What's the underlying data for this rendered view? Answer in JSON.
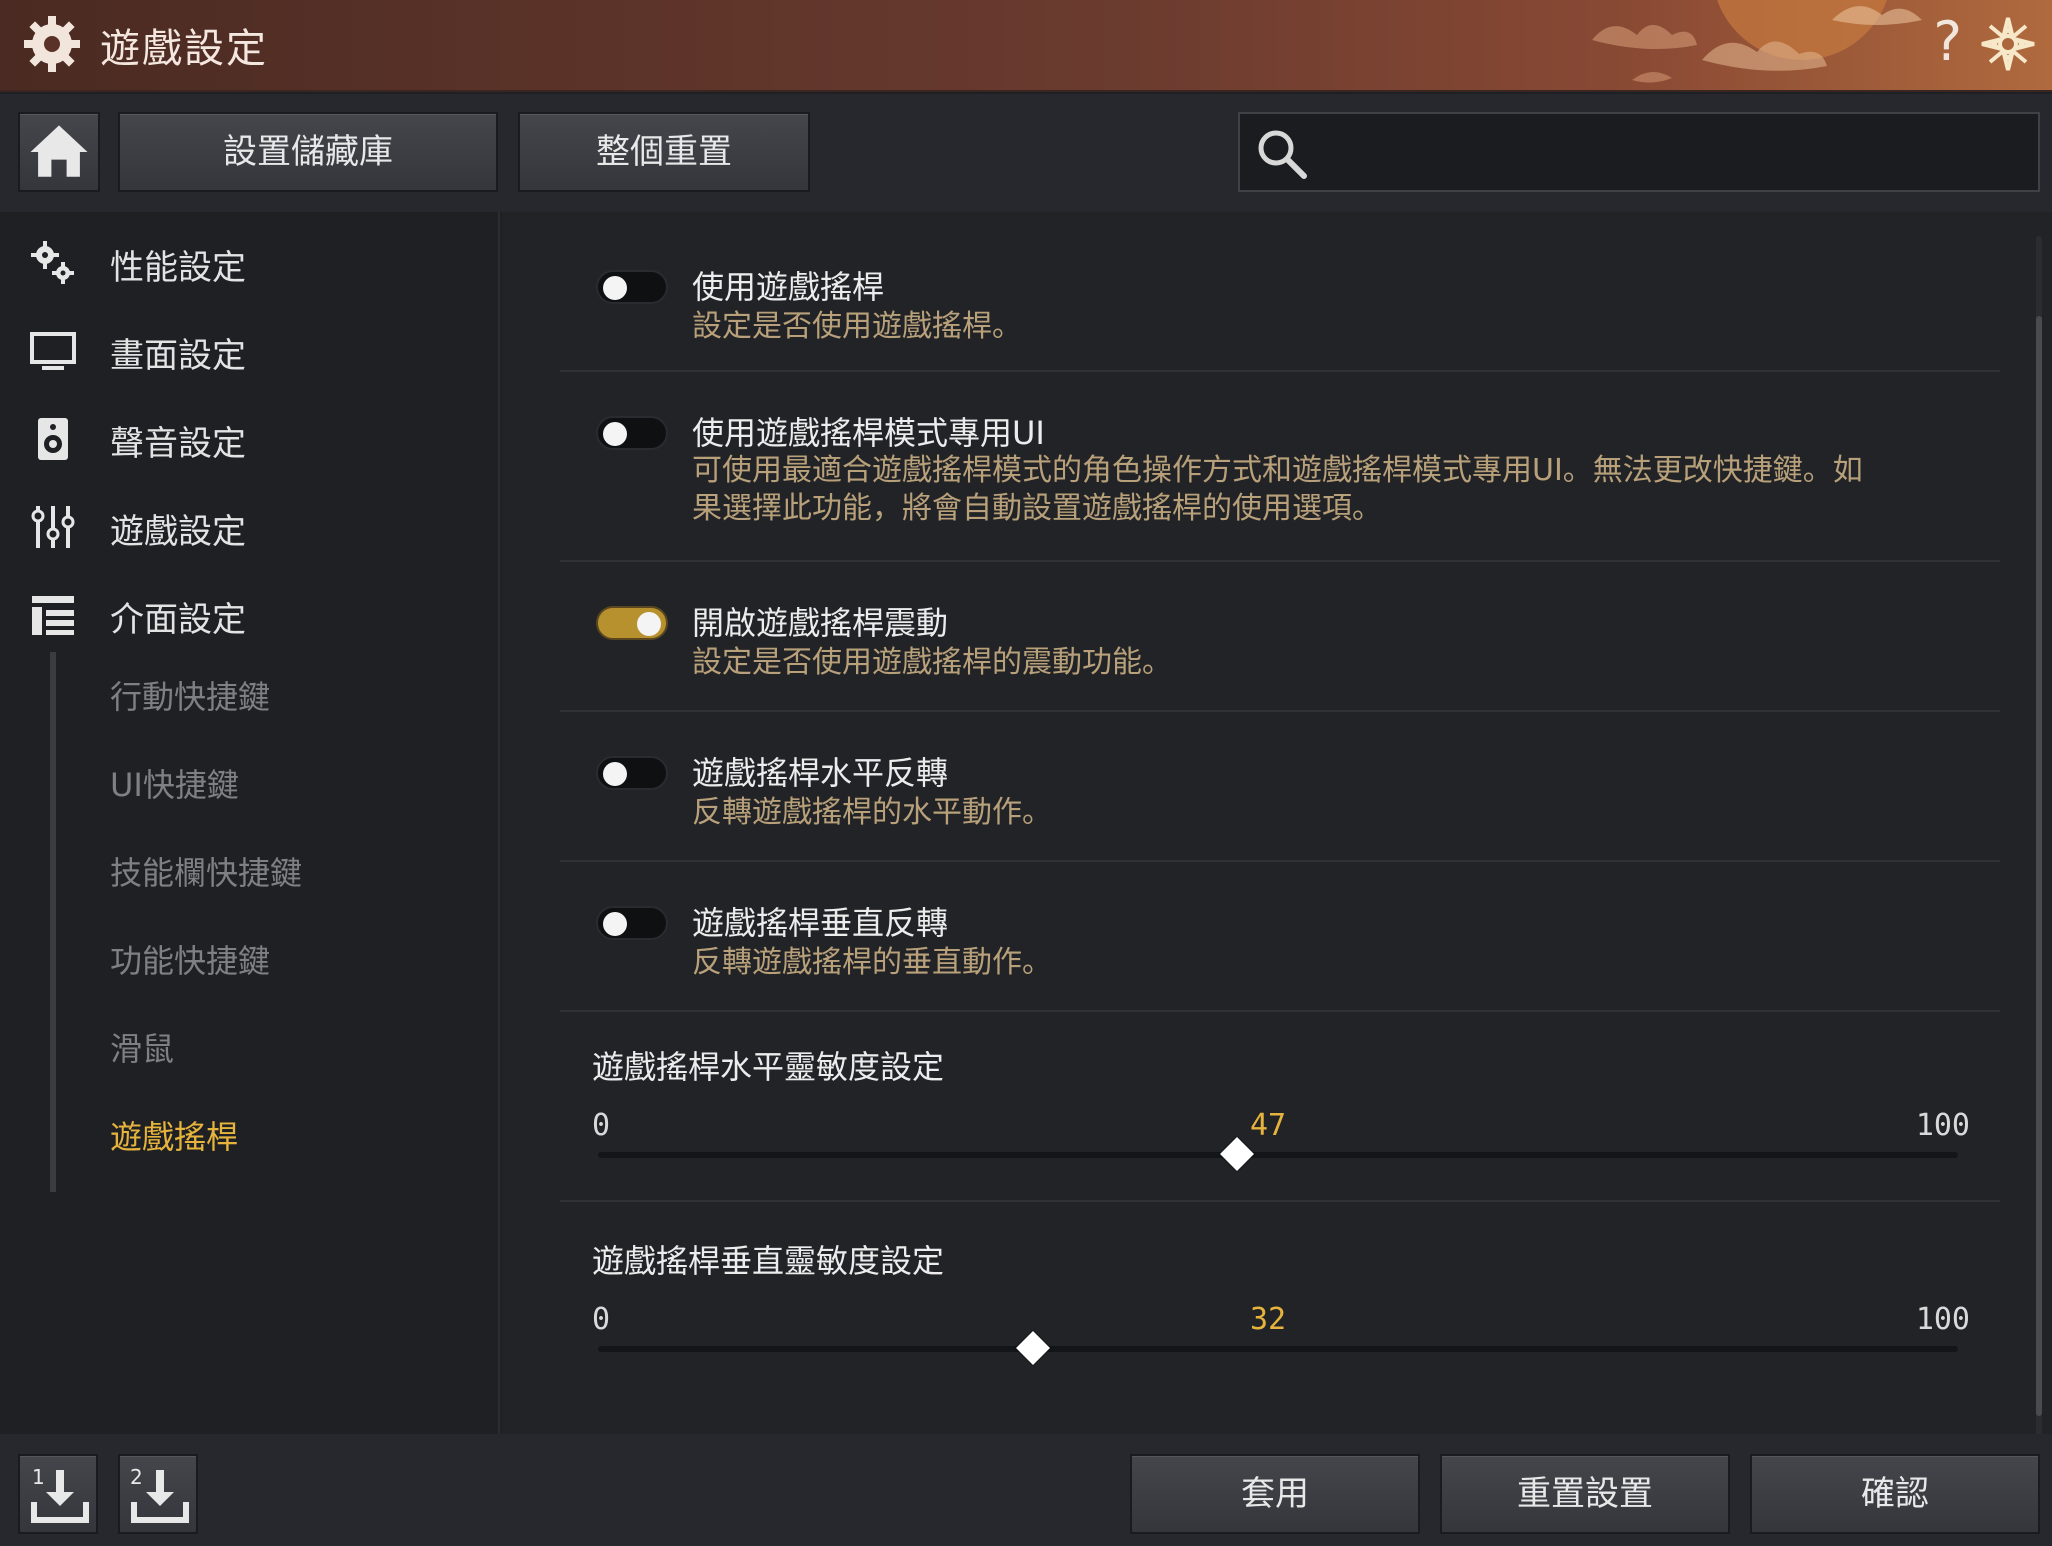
{
  "window": {
    "title": "遊戲設定",
    "help_label": "?"
  },
  "toolbar": {
    "store_label": "設置儲藏庫",
    "reset_all_label": "整個重置",
    "search_placeholder": ""
  },
  "sidebar": {
    "items": [
      {
        "label": "性能設定",
        "icon": "gears-icon"
      },
      {
        "label": "畫面設定",
        "icon": "monitor-icon"
      },
      {
        "label": "聲音設定",
        "icon": "speaker-icon"
      },
      {
        "label": "遊戲設定",
        "icon": "sliders-icon"
      },
      {
        "label": "介面設定",
        "icon": "layout-icon"
      }
    ],
    "subitems": [
      {
        "label": "行動快捷鍵",
        "active": false
      },
      {
        "label": "UI快捷鍵",
        "active": false
      },
      {
        "label": "技能欄快捷鍵",
        "active": false
      },
      {
        "label": "功能快捷鍵",
        "active": false
      },
      {
        "label": "滑鼠",
        "active": false
      },
      {
        "label": "遊戲搖桿",
        "active": true
      }
    ]
  },
  "settings": [
    {
      "title": "使用遊戲搖桿",
      "desc": "設定是否使用遊戲搖桿。",
      "on": false
    },
    {
      "title": "使用遊戲搖桿模式專用UI",
      "desc": "可使用最適合遊戲搖桿模式的角色操作方式和遊戲搖桿模式專用UI。無法更改快捷鍵。如果選擇此功能，將會自動設置遊戲搖桿的使用選項。",
      "on": false
    },
    {
      "title": "開啟遊戲搖桿震動",
      "desc": "設定是否使用遊戲搖桿的震動功能。",
      "on": true
    },
    {
      "title": "遊戲搖桿水平反轉",
      "desc": "反轉遊戲搖桿的水平動作。",
      "on": false
    },
    {
      "title": "遊戲搖桿垂直反轉",
      "desc": "反轉遊戲搖桿的垂直動作。",
      "on": false
    }
  ],
  "sliders": [
    {
      "title": "遊戲搖桿水平靈敏度設定",
      "min": "0",
      "max": "100",
      "value": "47",
      "fraction": 0.47
    },
    {
      "title": "遊戲搖桿垂直靈敏度設定",
      "min": "0",
      "max": "100",
      "value": "32",
      "fraction": 0.32
    }
  ],
  "bottom": {
    "apply_label": "套用",
    "reset_settings_label": "重置設置",
    "confirm_label": "確認",
    "preset1_label": "1",
    "preset2_label": "2"
  },
  "colors": {
    "accent": "#e6b43c",
    "toggle_on": "#b8912f",
    "desc_text": "#b8a17a"
  }
}
